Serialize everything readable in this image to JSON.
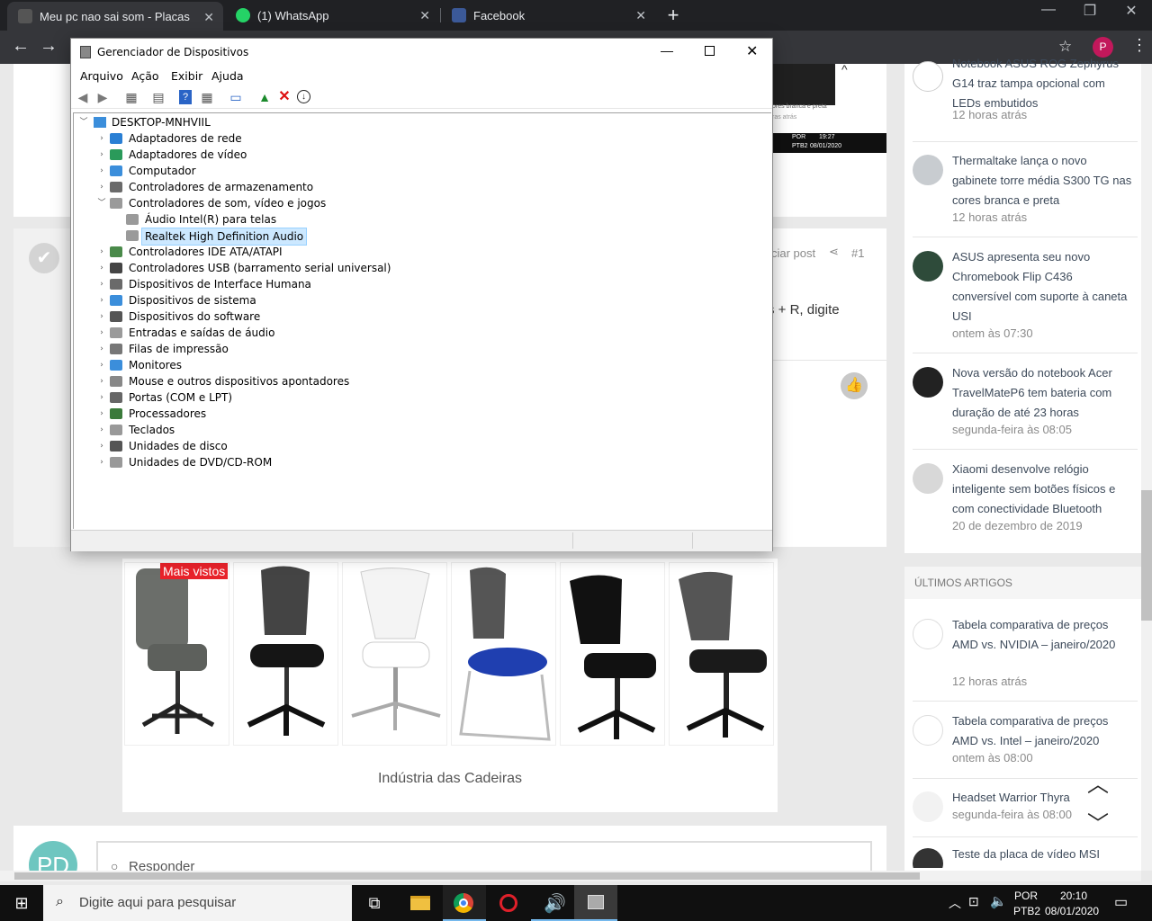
{
  "browser": {
    "tabs": [
      {
        "title": "Meu pc nao sai som - Placas de s"
      },
      {
        "title": "(1) WhatsApp"
      },
      {
        "title": "Facebook"
      }
    ],
    "new_tab": "+",
    "close": "✕",
    "window_controls": {
      "minimize": "—",
      "restore": "❐",
      "close": "✕"
    },
    "profile_initial": "P"
  },
  "page": {
    "post": {
      "share_text": "ciar post",
      "post_number": "#1",
      "body_fragment": "s + R, digite"
    },
    "reply_placeholder": "Responder",
    "avatar_initials": "PD",
    "ad": {
      "badge": "Mais vistos",
      "caption": "Indústria das Cadeiras"
    },
    "embedded_screenshot": {
      "text1": "ores branca e preta",
      "text2": "ras atrás",
      "lang": "POR",
      "kb": "PTB2",
      "time": "19:27",
      "date": "08/01/2020"
    },
    "sidebar": {
      "news": [
        {
          "title": "Notebook ASUS ROG Zephyrus G14 traz tampa opcional com LEDs embutidos",
          "time": "12 horas atrás"
        },
        {
          "title": "Thermaltake lança o novo gabinete torre média S300 TG nas cores branca e preta",
          "time": "12 horas atrás"
        },
        {
          "title": "ASUS apresenta seu novo Chromebook Flip C436 conversível com suporte à caneta USI",
          "time": "ontem às 07:30"
        },
        {
          "title": "Nova versão do notebook Acer TravelMateP6 tem bateria com duração de até 23 horas",
          "time": "segunda-feira às 08:05"
        },
        {
          "title": "Xiaomi desenvolve relógio inteligente sem botões físicos e com conectividade Bluetooth",
          "time": "20 de dezembro de 2019"
        }
      ],
      "articles_header": "ÚLTIMOS ARTIGOS",
      "articles": [
        {
          "title": "Tabela comparativa de preços AMD vs. NVIDIA – janeiro/2020",
          "time": "12 horas atrás"
        },
        {
          "title": "Tabela comparativa de preços AMD vs. Intel – janeiro/2020",
          "time": "ontem às 08:00"
        },
        {
          "title": "Headset Warrior Thyra",
          "time": "segunda-feira às 08:00"
        },
        {
          "title": "Teste da placa de vídeo MSI",
          "time": ""
        }
      ]
    }
  },
  "device_manager": {
    "title": "Gerenciador de Dispositivos",
    "menu": [
      "Arquivo",
      "Ação",
      "Exibir",
      "Ajuda"
    ],
    "root": "DESKTOP-MNHVIIL",
    "categories": [
      {
        "label": "Adaptadores de rede",
        "icon": "network-icon",
        "expanded": false
      },
      {
        "label": "Adaptadores de vídeo",
        "icon": "display-adapter-icon",
        "expanded": false
      },
      {
        "label": "Computador",
        "icon": "computer-icon",
        "expanded": false
      },
      {
        "label": "Controladores de armazenamento",
        "icon": "storage-controller-icon",
        "expanded": false
      },
      {
        "label": "Controladores de som, vídeo e jogos",
        "icon": "speaker-icon",
        "expanded": true
      },
      {
        "label": "Áudio Intel(R) para telas",
        "icon": "speaker-icon",
        "child": true
      },
      {
        "label": "Realtek High Definition Audio",
        "icon": "speaker-icon",
        "child": true,
        "selected": true
      },
      {
        "label": "Controladores IDE ATA/ATAPI",
        "icon": "ide-icon",
        "expanded": false
      },
      {
        "label": "Controladores USB (barramento serial universal)",
        "icon": "usb-icon",
        "expanded": false
      },
      {
        "label": "Dispositivos de Interface Humana",
        "icon": "hid-icon",
        "expanded": false
      },
      {
        "label": "Dispositivos de sistema",
        "icon": "system-device-icon",
        "expanded": false
      },
      {
        "label": "Dispositivos do software",
        "icon": "software-device-icon",
        "expanded": false
      },
      {
        "label": "Entradas e saídas de áudio",
        "icon": "speaker-icon",
        "expanded": false
      },
      {
        "label": "Filas de impressão",
        "icon": "printer-icon",
        "expanded": false
      },
      {
        "label": "Monitores",
        "icon": "monitor-icon",
        "expanded": false
      },
      {
        "label": "Mouse e outros dispositivos apontadores",
        "icon": "mouse-icon",
        "expanded": false
      },
      {
        "label": "Portas (COM e LPT)",
        "icon": "port-icon",
        "expanded": false
      },
      {
        "label": "Processadores",
        "icon": "processor-icon",
        "expanded": false
      },
      {
        "label": "Teclados",
        "icon": "keyboard-icon",
        "expanded": false
      },
      {
        "label": "Unidades de disco",
        "icon": "disk-drive-icon",
        "expanded": false
      },
      {
        "label": "Unidades de DVD/CD-ROM",
        "icon": "dvd-icon",
        "expanded": false
      }
    ]
  },
  "taskbar": {
    "search_placeholder": "Digite aqui para pesquisar",
    "lang": "POR",
    "kb": "PTB2",
    "time": "20:10",
    "date": "08/01/2020"
  },
  "colors": {
    "selection": "#cce8ff",
    "link": "#3d4a5a",
    "accent": "#e8222a"
  }
}
